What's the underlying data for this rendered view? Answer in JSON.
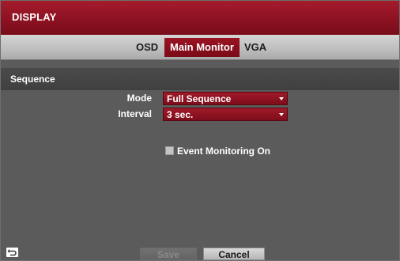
{
  "window": {
    "title": "DISPLAY"
  },
  "tabs": [
    {
      "label": "OSD",
      "active": false
    },
    {
      "label": "Main Monitor",
      "active": true
    },
    {
      "label": "VGA",
      "active": false
    }
  ],
  "section": {
    "title": "Sequence"
  },
  "fields": {
    "mode": {
      "label": "Mode",
      "value": "Full Sequence"
    },
    "interval": {
      "label": "Interval",
      "value": "3 sec."
    }
  },
  "event_monitoring": {
    "label": "Event Monitoring On",
    "checked": false
  },
  "footer": {
    "back_icon": "back-arrow-icon",
    "save_label": "Save",
    "save_enabled": false,
    "cancel_label": "Cancel"
  },
  "colors": {
    "accent": "#8d1222",
    "panel": "#5b5b5b",
    "section": "#444444",
    "tabstrip": "#bdbdbd"
  }
}
